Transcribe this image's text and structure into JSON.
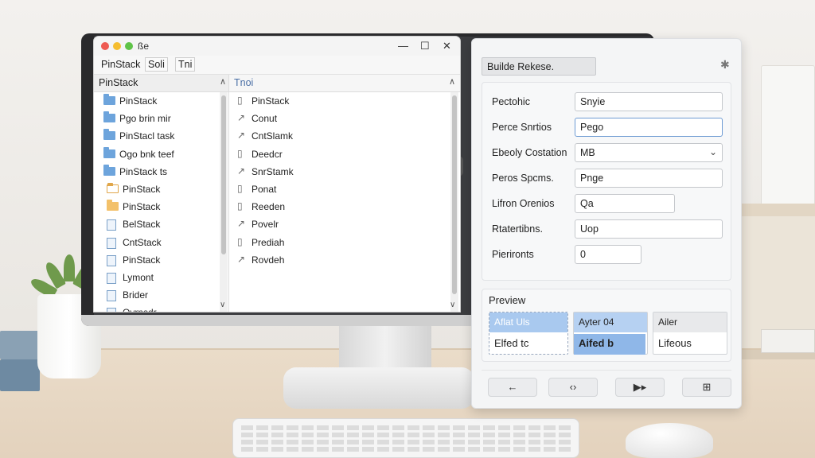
{
  "file_manager": {
    "title": "ße",
    "menu": [
      "PinStack",
      "Soli",
      "Tni"
    ],
    "left_pane": {
      "header": "PinStack",
      "items": [
        {
          "label": "PinStack",
          "icon": "folder-icon"
        },
        {
          "label": "Pgo brin mir",
          "icon": "folder-icon"
        },
        {
          "label": "PinStacl task",
          "icon": "folder-icon"
        },
        {
          "label": "Ogo bnk teef",
          "icon": "folder-icon"
        },
        {
          "label": "PinStack ts",
          "icon": "folder-icon"
        },
        {
          "label": "PinStack",
          "icon": "open-folder-icon"
        },
        {
          "label": "PinStack",
          "icon": "yellow-folder-icon"
        },
        {
          "label": "BelStack",
          "icon": "document-icon"
        },
        {
          "label": "CntStack",
          "icon": "document-icon"
        },
        {
          "label": "PinStack",
          "icon": "document-icon"
        },
        {
          "label": "Lymont",
          "icon": "document-icon"
        },
        {
          "label": "Brider",
          "icon": "document-icon"
        },
        {
          "label": "Ovrnsdr",
          "icon": "document-icon"
        }
      ]
    },
    "right_pane": {
      "header": "Tnoi",
      "items": [
        {
          "label": "PinStack",
          "icon": "file-icon"
        },
        {
          "label": "Conut",
          "icon": "link-icon"
        },
        {
          "label": "CntSlamk",
          "icon": "link-icon"
        },
        {
          "label": "Deedcr",
          "icon": "file-icon"
        },
        {
          "label": "SnrStamk",
          "icon": "link-icon"
        },
        {
          "label": "Ponat",
          "icon": "file-icon"
        },
        {
          "label": "Reeden",
          "icon": "file-icon"
        },
        {
          "label": "Povelr",
          "icon": "link-icon"
        },
        {
          "label": "Prediah",
          "icon": "file-icon"
        },
        {
          "label": "Rovdeh",
          "icon": "link-icon"
        }
      ]
    }
  },
  "dialog": {
    "title": "Builde Rekese.",
    "fields": [
      {
        "label": "Pectohic",
        "value": "Snyie",
        "type": "text"
      },
      {
        "label": "Perce Snrtios",
        "value": "Pego",
        "type": "text",
        "focused": true
      },
      {
        "label": "Ebeoly Costation",
        "value": "MB",
        "type": "select"
      },
      {
        "label": "Peros Spcms.",
        "value": "Pnge",
        "type": "text"
      },
      {
        "label": "Lifron Orenios",
        "value": "Qa",
        "type": "text"
      },
      {
        "label": "Rtatertibns.",
        "value": "Uop",
        "type": "text"
      },
      {
        "label": "Pierironts",
        "value": "0",
        "type": "text"
      }
    ],
    "preview": {
      "label": "Preview",
      "cards": [
        {
          "head": "Aflat Uls",
          "body": "Elfed tc"
        },
        {
          "head": "Ayter 04",
          "body": "Aifed b"
        },
        {
          "head": "Ailer",
          "body": "Lifeous"
        }
      ]
    },
    "nav_buttons": [
      {
        "label": "←",
        "icon": "back-arrow-icon"
      },
      {
        "label": "‹›",
        "icon": "code-brackets-icon"
      },
      {
        "label": "▶▸",
        "icon": "forward-icon"
      },
      {
        "label": "⊞",
        "icon": "grid-icon"
      }
    ]
  }
}
